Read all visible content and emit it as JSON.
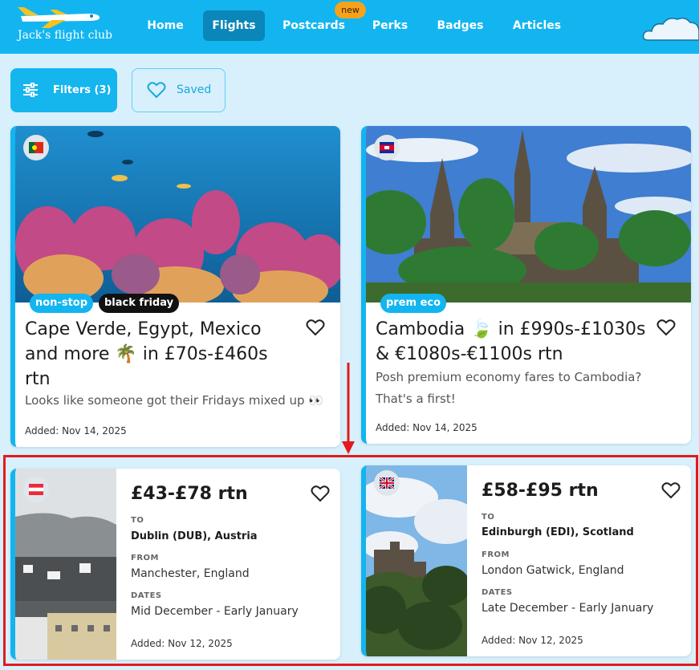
{
  "header": {
    "logo_text": "Jack's flight club",
    "nav": [
      {
        "label": "Home"
      },
      {
        "label": "Flights"
      },
      {
        "label": "Postcards"
      },
      {
        "label": "Perks"
      },
      {
        "label": "Badges"
      },
      {
        "label": "Articles"
      }
    ],
    "postcards_badge": "new"
  },
  "toolbar": {
    "filters_label": "Filters (3)",
    "saved_label": "Saved"
  },
  "deals": [
    {
      "flag": "portugal",
      "tags": [
        "non-stop",
        "black friday"
      ],
      "title_lines": [
        "Cape Verde, Egypt, Mexico",
        "and more 🌴 in £70s-£460s",
        "rtn"
      ],
      "subtitle": "Looks like someone got their Fridays mixed up 👀",
      "added": "Added: Nov 14, 2025"
    },
    {
      "flag": "cambodia",
      "tags": [
        "prem eco"
      ],
      "title_lines": [
        "Cambodia 🍃 in £990s-£1030s",
        "& €1080s-€1100s rtn"
      ],
      "subtitle_lines": [
        "Posh premium economy fares to Cambodia?",
        "That's a first!"
      ],
      "added": "Added: Nov 14, 2025"
    },
    {
      "flag": "austria",
      "price": "£43-£78 rtn",
      "to_label": "TO",
      "to": "Dublin (DUB), Austria",
      "from_label": "FROM",
      "from": "Manchester, England",
      "dates_label": "DATES",
      "dates": "Mid December - Early January",
      "added": "Added: Nov 12, 2025"
    },
    {
      "flag": "uk",
      "price": "£58-£95 rtn",
      "to_label": "TO",
      "to": "Edinburgh (EDI), Scotland",
      "from_label": "FROM",
      "from": "London Gatwick, England",
      "dates_label": "DATES",
      "dates": "Late December - Early January",
      "added": "Added: Nov 12, 2025"
    }
  ],
  "colors": {
    "brand": "#12b5f0",
    "annotation": "#e21b1b",
    "badge": "#f7a21b"
  }
}
